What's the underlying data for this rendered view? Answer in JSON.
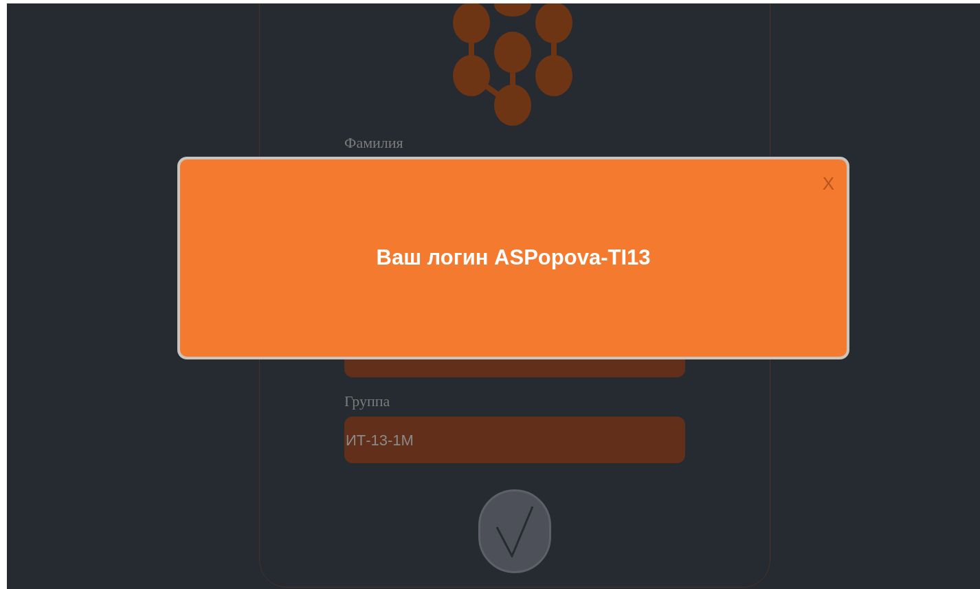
{
  "form": {
    "surname_label": "Фамилия",
    "group": {
      "label": "Группа",
      "value": "ИТ-13-1М"
    }
  },
  "dialog": {
    "close": "X",
    "message": "Ваш логин ASPopova-TI13"
  }
}
